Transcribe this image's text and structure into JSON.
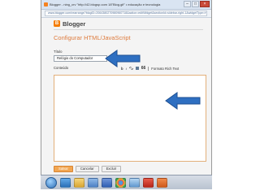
{
  "browser": {
    "tab_title": "Blogger - ning_crv \"http://42.blogsp.com 18\"Blog.gif\" • educação e tecnologia",
    "url": "www.blogger.com/rearrange?blogID=2064380270980960718&action=editWidget&sectionId=sidebar-right-1&widgetType=HTML"
  },
  "header": {
    "brand_logo_letter": "B",
    "brand_name": "Blogger"
  },
  "form": {
    "page_title": "Configurar HTML/JavaScript",
    "titulo_label": "Título",
    "titulo_value": "Relógio do Computador",
    "conteudo_label": "Conteúdo",
    "toolbar": {
      "bold": "b",
      "italic": "i",
      "quote": "66",
      "rich_text_link": "Formato Rich Text"
    },
    "buttons": {
      "save": "Salvar",
      "cancel": "Cancelar",
      "delete": "Excluir"
    }
  },
  "taskbar": {
    "icons": [
      "windows-start-icon",
      "internet-explorer-icon",
      "file-explorer-icon",
      "media-player-icon",
      "word-icon",
      "chrome-icon",
      "paint-icon",
      "acrobat-icon",
      "powerpoint-icon"
    ]
  },
  "colors": {
    "accent_orange": "#de7b3d",
    "annotation_arrow": "#2e6fc1"
  }
}
